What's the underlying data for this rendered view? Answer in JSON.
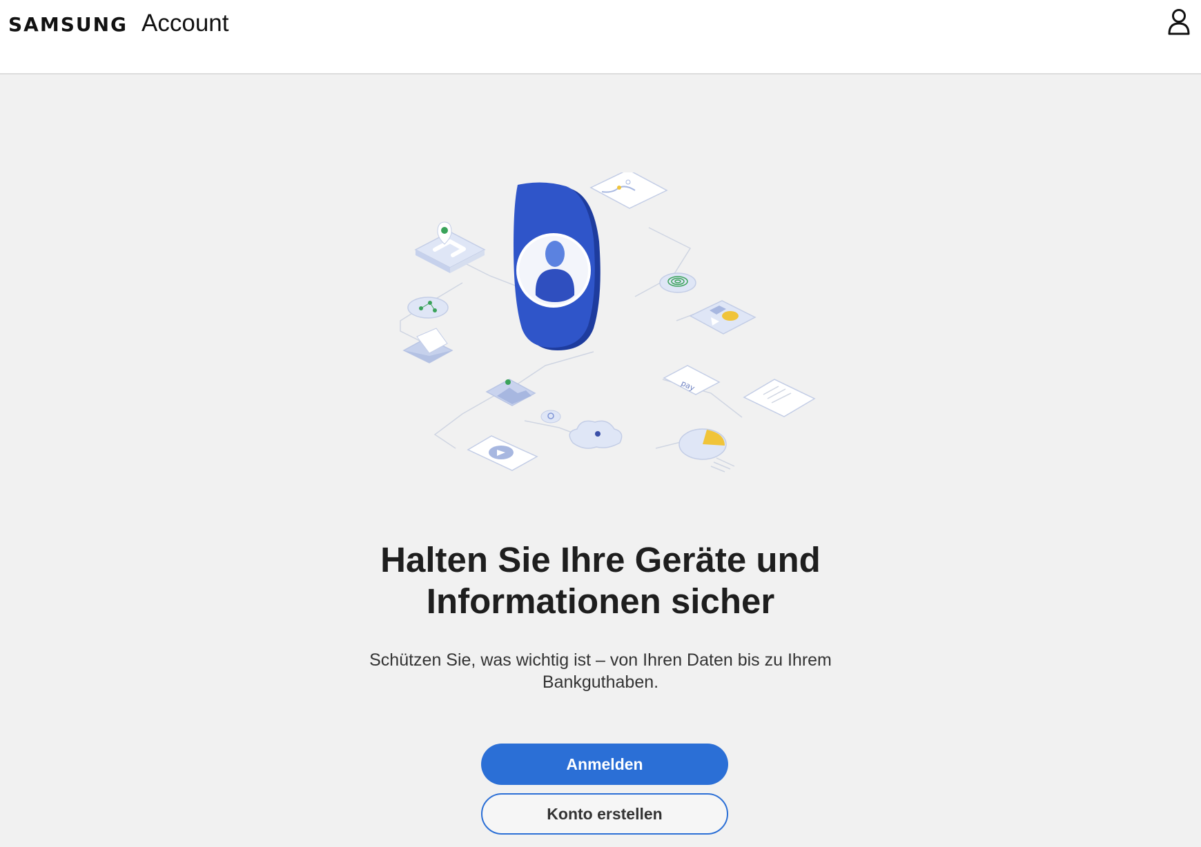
{
  "header": {
    "brand_samsung": "SAMSUNG",
    "brand_account": "Account",
    "profile_icon": "person-outline-icon"
  },
  "main": {
    "headline_line1": "Halten Sie Ihre Geräte und",
    "headline_line2": "Informationen sicher",
    "subtitle_line1": "Schützen Sie, was wichtig ist – von Ihren Daten bis zu Ihrem",
    "subtitle_line2": "Bankguthaben.",
    "hero_pay_label": "pay"
  },
  "actions": {
    "sign_in_label": "Anmelden",
    "create_account_label": "Konto erstellen"
  },
  "colors": {
    "primary_blue": "#2b6fd6",
    "badge_blue": "#2f55c9",
    "accent_green": "#3aa35a",
    "accent_yellow": "#f0c43a",
    "page_background": "#f1f1f1"
  }
}
